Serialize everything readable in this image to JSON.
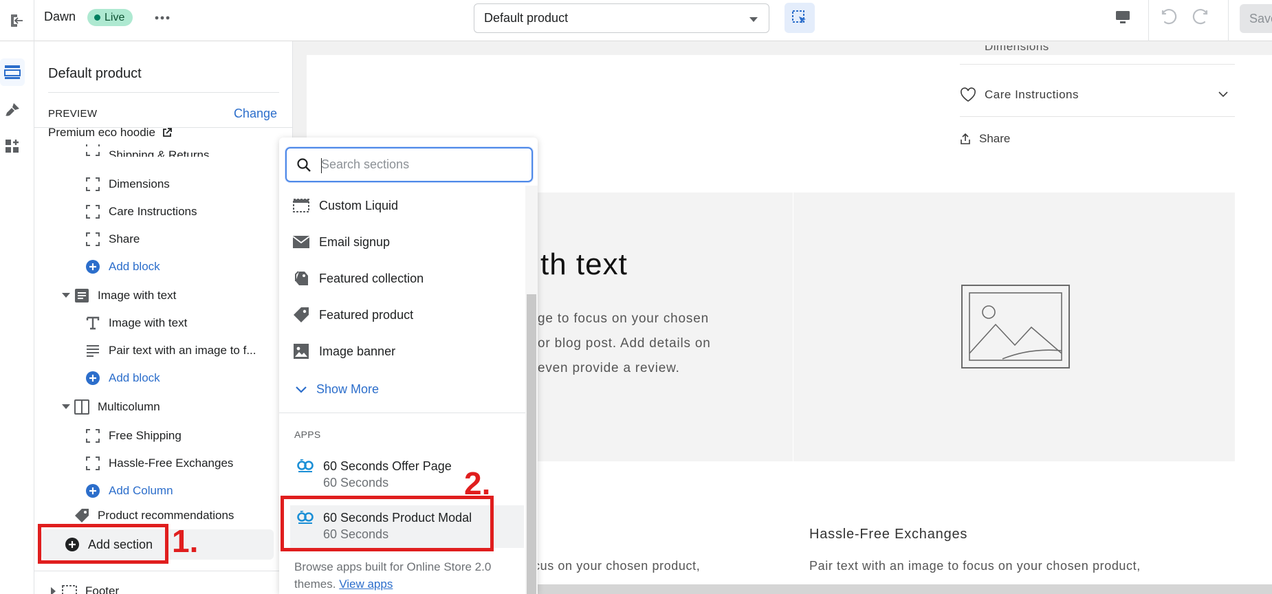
{
  "topbar": {
    "theme_name": "Dawn",
    "live_badge": "Live",
    "template_select": "Default product",
    "save_label": "Save"
  },
  "sidebar": {
    "title": "Default product",
    "preview_label": "PREVIEW",
    "change_link": "Change",
    "preview_product": "Premium eco hoodie",
    "partial_top_item": "Shipping & Returns",
    "items": [
      {
        "label": "Dimensions"
      },
      {
        "label": "Care Instructions"
      },
      {
        "label": "Share"
      },
      {
        "label": "Add block"
      }
    ],
    "image_with_text": {
      "label": "Image with text",
      "children": [
        "Image with text",
        "Pair text with an image to f...",
        "Add block"
      ]
    },
    "multicolumn": {
      "label": "Multicolumn",
      "children": [
        "Free Shipping",
        "Hassle-Free Exchanges",
        "Add Column"
      ]
    },
    "product_recommendations": "Product recommendations",
    "add_section": "Add section",
    "footer": "Footer"
  },
  "annotations": {
    "step1": "1.",
    "step2": "2."
  },
  "dropdown": {
    "search_placeholder": "Search sections",
    "items": [
      {
        "label": "Custom Liquid",
        "icon": "custom-liquid-icon"
      },
      {
        "label": "Email signup",
        "icon": "envelope-icon"
      },
      {
        "label": "Featured collection",
        "icon": "tags-icon"
      },
      {
        "label": "Featured product",
        "icon": "tag-icon"
      },
      {
        "label": "Image banner",
        "icon": "image-icon"
      }
    ],
    "show_more": "Show More",
    "apps_heading": "APPS",
    "apps": [
      {
        "title": "60 Seconds Offer Page",
        "subtitle": "60 Seconds"
      },
      {
        "title": "60 Seconds Product Modal",
        "subtitle": "60 Seconds"
      }
    ],
    "footer_text": "Browse apps built for Online Store 2.0 themes.",
    "footer_link": "View apps"
  },
  "canvas": {
    "accordion_partial": "Dimensions",
    "accordion_care": "Care Instructions",
    "share": "Share",
    "iwt_heading": "th text",
    "iwt_body": [
      "ge to focus on your chosen",
      "or blog post. Add details on",
      "even provide a review."
    ],
    "mc_heading": "Hassle-Free Exchanges",
    "mc_body_left": "cus on your chosen product,",
    "mc_body_right": "Pair text with an image to focus on your chosen product,"
  },
  "colors": {
    "accent": "#2c6ecb",
    "annotation": "#e01e1e",
    "live_badge_bg": "#aee9d1"
  }
}
